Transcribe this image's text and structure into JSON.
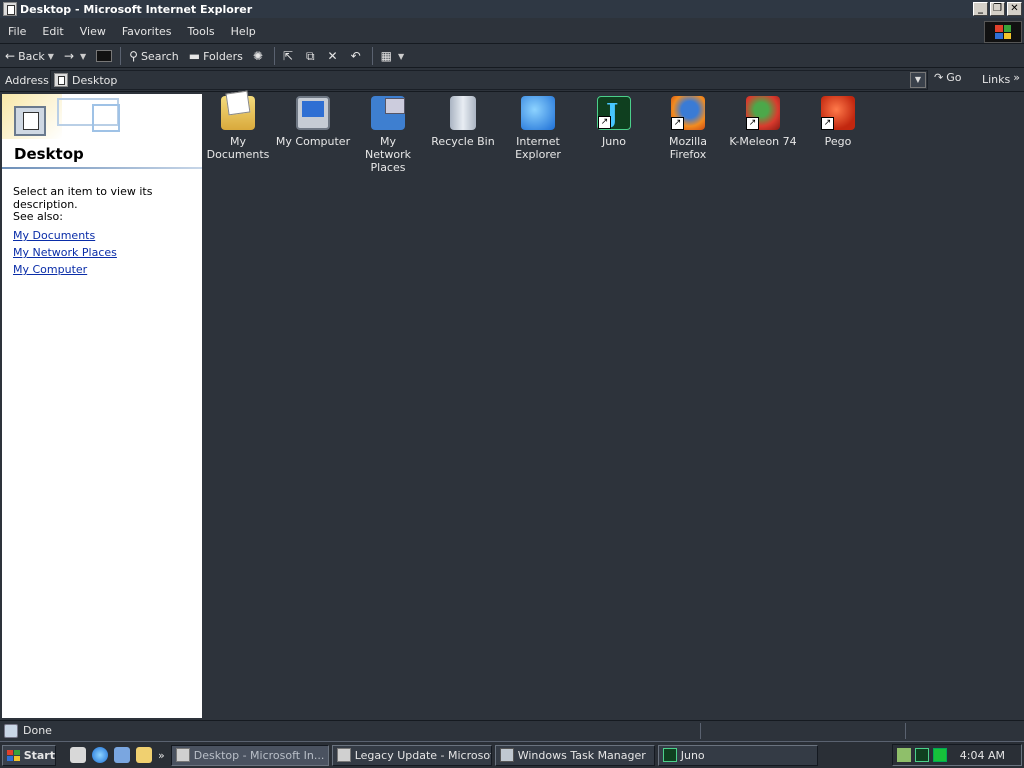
{
  "window": {
    "title": "Desktop - Microsoft Internet Explorer",
    "controls": {
      "minimize": "_",
      "maximize": "❐",
      "close": "✕"
    }
  },
  "menu": [
    "File",
    "Edit",
    "View",
    "Favorites",
    "Tools",
    "Help"
  ],
  "toolbar": {
    "back_label": "Back",
    "search_label": "Search",
    "folders_label": "Folders"
  },
  "address": {
    "label": "Address",
    "value": "Desktop",
    "go_label": "Go",
    "links_label": "Links"
  },
  "left_pane": {
    "title": "Desktop",
    "description": "Select an item to view its description.",
    "see_also_label": "See also:",
    "links": [
      "My Documents",
      "My Network Places",
      "My Computer"
    ]
  },
  "desktop_icons": [
    {
      "label": "My Documents",
      "icon": "my-documents-icon"
    },
    {
      "label": "My Computer",
      "icon": "my-computer-icon"
    },
    {
      "label": "My Network Places",
      "icon": "network-places-icon"
    },
    {
      "label": "Recycle Bin",
      "icon": "recycle-bin-icon"
    },
    {
      "label": "Internet Explorer",
      "icon": "internet-explorer-icon"
    },
    {
      "label": "Juno",
      "icon": "juno-icon"
    },
    {
      "label": "Mozilla Firefox",
      "icon": "firefox-icon"
    },
    {
      "label": "K-Meleon 74",
      "icon": "k-meleon-icon"
    },
    {
      "label": "Pego",
      "icon": "pego-icon"
    }
  ],
  "status": {
    "text": "Done"
  },
  "taskbar": {
    "start_label": "Start",
    "tasks": [
      "Desktop - Microsoft In...",
      "Legacy Update - Microsof...",
      "Windows Task Manager",
      "Juno"
    ],
    "clock": "4:04 AM"
  },
  "colors": {
    "theme_bg": "#2d333b",
    "link": "#0a2da8",
    "pane_bg": "#ffffff"
  }
}
